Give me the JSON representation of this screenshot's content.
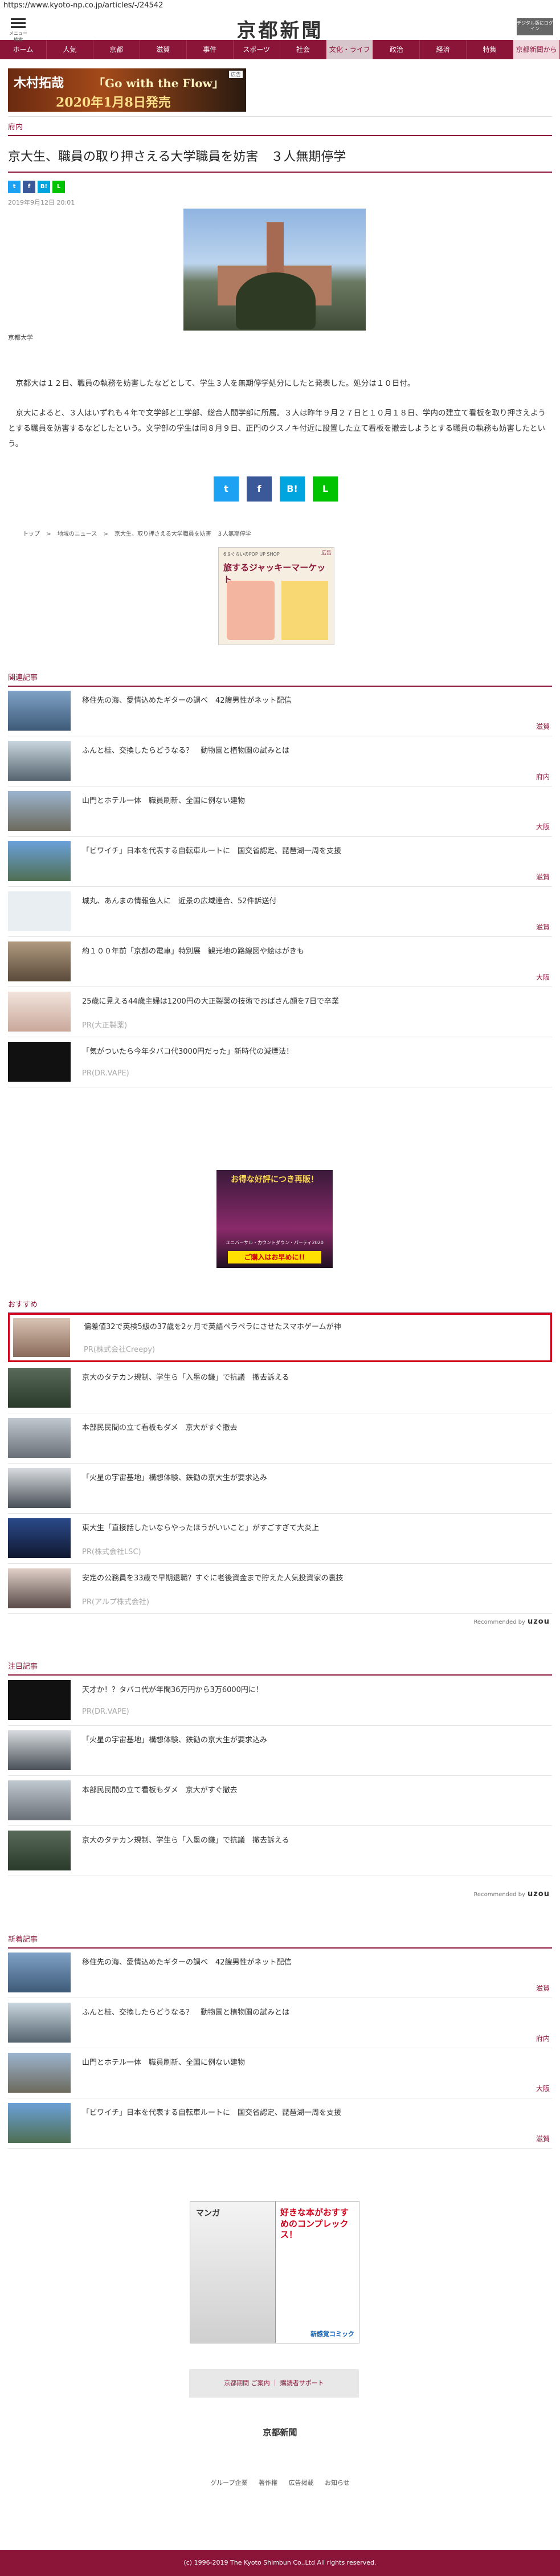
{
  "url": "https://www.kyoto-np.co.jp/articles/-/24542",
  "header": {
    "menu_label": "メニュー 検索",
    "logo": "京都新聞",
    "digital_button": "デジタル版にログイン"
  },
  "nav": [
    "ホーム",
    "人気",
    "京都",
    "滋賀",
    "事件",
    "スポーツ",
    "社会",
    "文化・ライフ",
    "政治",
    "経済",
    "特集",
    "京都新聞から"
  ],
  "banner": {
    "line1": "木村拓哉",
    "line2": "「Go with the Flow」",
    "line3": "2020年1月8日発売",
    "ad": "広告"
  },
  "article": {
    "category": "府内",
    "headline": "京大生、職員の取り押さえる大学職員を妨害　３人無期停学",
    "share_small": [
      "t",
      "f",
      "B!",
      "L"
    ],
    "date": "2019年9月12日 20:01",
    "caption": "京都大学",
    "paragraph1": "京都大は１２日、職員の執務を妨害したなどとして、学生３人を無期停学処分にしたと発表した。処分は１０日付。",
    "paragraph2": "京大によると、３人はいずれも４年で文学部と工学部、総合人間学部に所属。３人は昨年９月２７日と１０月１８日、学内の建立て看板を取り押さえようとする職員を妨害するなどしたという。文学部の学生は同８月９日、正門のクスノキ付近に設置した立て看板を撤去しようとする職員の執務も妨害したという。",
    "share_large": [
      "t",
      "f",
      "B!",
      "L"
    ]
  },
  "breadcrumb": [
    "トップ",
    ">",
    "地域のニュース",
    ">",
    "京大生、取り押さえる大学職員を妨害　３人無期停学"
  ],
  "ad1": {
    "badge": "広告",
    "title": "旅するジャッキーマーケット",
    "sub": "6.9ぐらいのPOP UP SHOP"
  },
  "related": {
    "title": "関連記事",
    "items": [
      {
        "title": "移住先の海、愛情込めたギターの調べ　42艘男性がネット配信",
        "tag": "滋賀"
      },
      {
        "title": "ふんと桂、交換したらどうなる？　動物園と植物園の試みとは",
        "tag": "府内"
      },
      {
        "title": "山門とホテル一体　職員刷新、全国に例ない建物",
        "tag": "大阪"
      },
      {
        "title": "「ビワイチ」日本を代表する自転車ルートに　国交省認定、琵琶湖一周を支援",
        "tag": "滋賀"
      },
      {
        "title": "城丸、あんまの情報色人に　近景の広域連合、52件訴送付",
        "tag": "滋賀"
      },
      {
        "title": "約１００年前「京都の電車」特別展　観光地の路線図や絵はがきも",
        "tag": "大阪"
      },
      {
        "title": "25歳に見える44歳主婦は1200円の大正製薬の技術でおばさん顔を7日で卒業",
        "pr": "PR(大正製薬)"
      },
      {
        "title": "「気がついたら今年タバコ代3000円だった」新時代の減煙法！",
        "pr": "PR(DR.VAPE)"
      }
    ]
  },
  "ad2": {
    "title": "お得な好評につき再販！",
    "sub": "ユニバーサル・カウントダウン・パーティ2020",
    "cta": "ご購入はお早めに!!"
  },
  "recommend": {
    "title": "おすすめ",
    "items": [
      {
        "title": "偏差値32で英検5級の37歳を2ヶ月で英語ペラペラにさせたスマホゲームが神",
        "pr": "PR(株式会社Creepy)"
      },
      {
        "title": "京大のタテカン規制、学生ら「入墨の鎌」で抗議　撤去訴える"
      },
      {
        "title": "本部民民間の立て看板もダメ　京大がすぐ撤去"
      },
      {
        "title": "「火星の宇宙基地」構想体験、鉄勧の京大生が要求込み"
      },
      {
        "title": "東大生「直接話したいならやったほうがいいこと」がすごすぎて大炎上",
        "pr": "PR(株式会社LSC)"
      },
      {
        "title": "安定の公務員を33歳で早期退職？すぐに老後資金まで貯えた人気投資家の裏技",
        "pr": "PR(アルプ株式会社)"
      }
    ],
    "recommended_by": "Recommended by",
    "brand": "uzou"
  },
  "attention": {
    "title": "注目記事",
    "items": [
      {
        "title": "天才か！？タバコ代が年間36万円から3万6000円に！",
        "pr": "PR(DR.VAPE)"
      },
      {
        "title": "「火星の宇宙基地」構想体験、鉄勧の京大生が要求込み"
      },
      {
        "title": "本部民民間の立て看板もダメ　京大がすぐ撤去"
      },
      {
        "title": "京大のタテカン規制、学生ら「入墨の鎌」で抗議　撤去訴える"
      }
    ],
    "recommended_by": "Recommended by",
    "brand": "uzou"
  },
  "latest": {
    "title": "新着記事",
    "items": [
      {
        "title": "移住先の海、愛情込めたギターの調べ　42艘男性がネット配信",
        "tag": "滋賀"
      },
      {
        "title": "ふんと桂、交換したらどうなる？　動物園と植物園の試みとは",
        "tag": "府内"
      },
      {
        "title": "山門とホテル一体　職員刷新、全国に例ない建物",
        "tag": "大阪"
      },
      {
        "title": "「ビワイチ」日本を代表する自転車ルートに　国交省認定、琵琶湖一周を支援",
        "tag": "滋賀"
      }
    ]
  },
  "ad3": {
    "left": "マンガ",
    "right": "好きな本がおすすめのコンプレックス！",
    "brand": "新感覚コミック"
  },
  "footer": {
    "buttons": "京都期間 ご案内 ｜ 購読者サポート",
    "logo": "京都新聞",
    "links": [
      "グループ企業",
      "著作権",
      "広告掲載",
      "お知らせ"
    ],
    "copyright": "(c) 1996-2019 The Kyoto Shimbun Co.,Ltd All rights reserved."
  },
  "colors": {
    "brand": "#8a1538",
    "twitter": "#1da1f2",
    "facebook": "#3b5998",
    "hatena": "#00a4de",
    "line": "#00c300"
  }
}
